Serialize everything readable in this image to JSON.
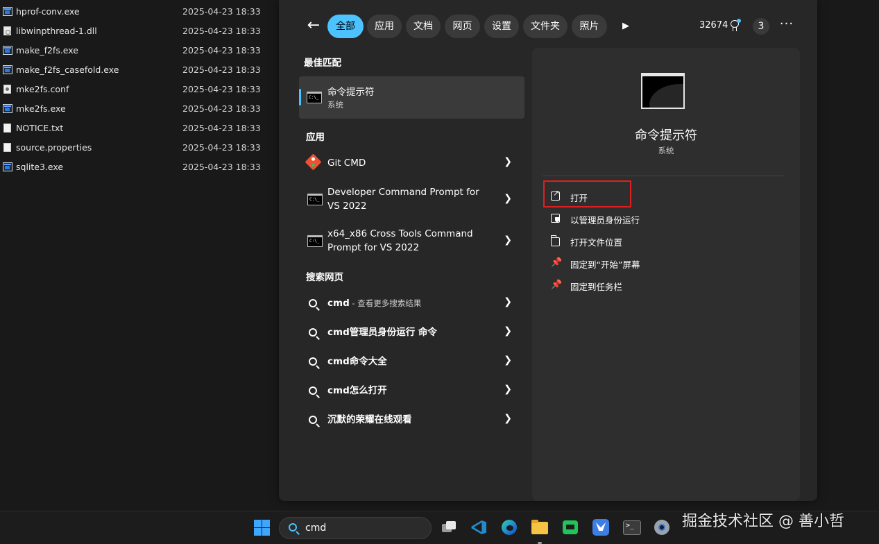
{
  "explorer": {
    "files": [
      {
        "name": "hprof-conv.exe",
        "date": "2025-04-23 18:33",
        "type": "exe"
      },
      {
        "name": "libwinpthread-1.dll",
        "date": "2025-04-23 18:33",
        "type": "dll"
      },
      {
        "name": "make_f2fs.exe",
        "date": "2025-04-23 18:33",
        "type": "exe"
      },
      {
        "name": "make_f2fs_casefold.exe",
        "date": "2025-04-23 18:33",
        "type": "exe"
      },
      {
        "name": "mke2fs.conf",
        "date": "2025-04-23 18:33",
        "type": "conf"
      },
      {
        "name": "mke2fs.exe",
        "date": "2025-04-23 18:33",
        "type": "exe"
      },
      {
        "name": "NOTICE.txt",
        "date": "2025-04-23 18:33",
        "type": "doc"
      },
      {
        "name": "source.properties",
        "date": "2025-04-23 18:33",
        "type": "doc"
      },
      {
        "name": "sqlite3.exe",
        "date": "2025-04-23 18:33",
        "type": "exe"
      }
    ]
  },
  "search_panel": {
    "filters": [
      "全部",
      "应用",
      "文档",
      "网页",
      "设置",
      "文件夹",
      "照片"
    ],
    "points": "32674",
    "badge": "3",
    "more": "···",
    "best_match_heading": "最佳匹配",
    "best_match": {
      "title": "命令提示符",
      "subtitle": "系统"
    },
    "apps_heading": "应用",
    "apps": [
      {
        "label": "Git CMD"
      },
      {
        "label_line1": "Developer Command Prompt for",
        "label_line2": "VS 2022"
      },
      {
        "label_line1": "x64_x86 Cross Tools Command",
        "label_line2": "Prompt for VS 2022"
      }
    ],
    "web_heading": "搜索网页",
    "web": [
      {
        "label": "cmd",
        "suffix": " - 查看更多搜索结果"
      },
      {
        "label": "cmd管理员身份运行 命令",
        "suffix": ""
      },
      {
        "label": "cmd命令大全",
        "suffix": ""
      },
      {
        "label": "cmd怎么打开",
        "suffix": ""
      },
      {
        "label": "沉默的荣耀在线观看",
        "suffix": ""
      }
    ],
    "cmd_icon_text": "C:\\_"
  },
  "detail": {
    "title": "命令提示符",
    "subtitle": "系统",
    "actions": [
      "打开",
      "以管理员身份运行",
      "打开文件位置",
      "固定到“开始”屏幕",
      "固定到任务栏"
    ]
  },
  "taskbar": {
    "search_text": "cmd",
    "accent": "#4cc2ff"
  },
  "watermark": "掘金技术社区 @ 善小哲"
}
